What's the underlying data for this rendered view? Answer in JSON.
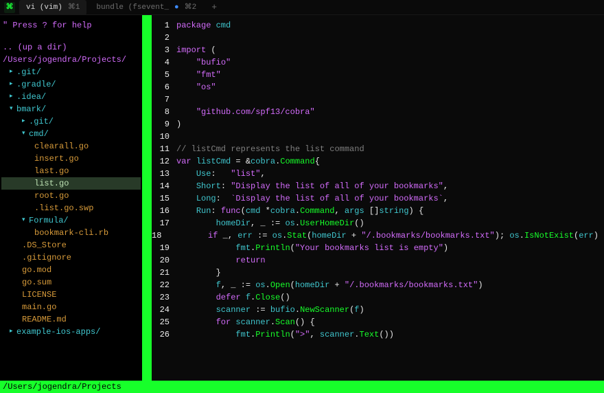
{
  "tabs": [
    {
      "label": "vi (vim)",
      "accel": "⌘1",
      "dot": false
    },
    {
      "label": "bundle (fsevent_",
      "accel": "⌘2",
      "dot": true
    }
  ],
  "help_line": "\" Press ? for help",
  "up_dir": ".. (up a dir)",
  "root_path": "/Users/jogendra/Projects/",
  "tree": [
    {
      "indent": 0,
      "arrow": "▸",
      "type": "dir",
      "name": ".git/"
    },
    {
      "indent": 0,
      "arrow": "▸",
      "type": "dir",
      "name": ".gradle/"
    },
    {
      "indent": 0,
      "arrow": "▸",
      "type": "dir",
      "name": ".idea/"
    },
    {
      "indent": 0,
      "arrow": "▾",
      "type": "dir",
      "name": "bmark/"
    },
    {
      "indent": 1,
      "arrow": "▸",
      "type": "dir",
      "name": ".git/"
    },
    {
      "indent": 1,
      "arrow": "▾",
      "type": "dir",
      "name": "cmd/"
    },
    {
      "indent": 2,
      "arrow": "",
      "type": "file",
      "name": "clearall.go"
    },
    {
      "indent": 2,
      "arrow": "",
      "type": "file",
      "name": "insert.go"
    },
    {
      "indent": 2,
      "arrow": "",
      "type": "file",
      "name": "last.go"
    },
    {
      "indent": 2,
      "arrow": "",
      "type": "file",
      "name": "list.go",
      "selected": true
    },
    {
      "indent": 2,
      "arrow": "",
      "type": "file",
      "name": "root.go"
    },
    {
      "indent": 2,
      "arrow": "",
      "type": "file",
      "name": ".list.go.swp"
    },
    {
      "indent": 1,
      "arrow": "▾",
      "type": "dir",
      "name": "Formula/"
    },
    {
      "indent": 2,
      "arrow": "",
      "type": "file",
      "name": "bookmark-cli.rb"
    },
    {
      "indent": 1,
      "arrow": "",
      "type": "file",
      "name": ".DS_Store"
    },
    {
      "indent": 1,
      "arrow": "",
      "type": "file",
      "name": ".gitignore"
    },
    {
      "indent": 1,
      "arrow": "",
      "type": "file",
      "name": "go.mod"
    },
    {
      "indent": 1,
      "arrow": "",
      "type": "file",
      "name": "go.sum"
    },
    {
      "indent": 1,
      "arrow": "",
      "type": "file",
      "name": "LICENSE"
    },
    {
      "indent": 1,
      "arrow": "",
      "type": "file",
      "name": "main.go"
    },
    {
      "indent": 1,
      "arrow": "",
      "type": "file",
      "name": "README.md"
    },
    {
      "indent": 0,
      "arrow": "▸",
      "type": "dir",
      "name": "example-ios-apps/"
    }
  ],
  "status": "/Users/jogendra/Projects",
  "code": [
    {
      "n": 1,
      "tokens": [
        [
          "kw",
          "package "
        ],
        [
          "ident",
          "cmd"
        ]
      ]
    },
    {
      "n": 2,
      "tokens": []
    },
    {
      "n": 3,
      "tokens": [
        [
          "kw",
          "import "
        ],
        [
          "white",
          "("
        ]
      ]
    },
    {
      "n": 4,
      "tokens": [
        [
          "white",
          "    "
        ],
        [
          "str",
          "\"bufio\""
        ]
      ]
    },
    {
      "n": 5,
      "tokens": [
        [
          "white",
          "    "
        ],
        [
          "str",
          "\"fmt\""
        ]
      ]
    },
    {
      "n": 6,
      "tokens": [
        [
          "white",
          "    "
        ],
        [
          "str",
          "\"os\""
        ]
      ]
    },
    {
      "n": 7,
      "tokens": []
    },
    {
      "n": 8,
      "tokens": [
        [
          "white",
          "    "
        ],
        [
          "str",
          "\"github.com/spf13/cobra\""
        ]
      ]
    },
    {
      "n": 9,
      "tokens": [
        [
          "white",
          ")"
        ]
      ]
    },
    {
      "n": 10,
      "tokens": []
    },
    {
      "n": 11,
      "tokens": [
        [
          "cmt",
          "// listCmd represents the list command"
        ]
      ]
    },
    {
      "n": 12,
      "tokens": [
        [
          "kw",
          "var "
        ],
        [
          "ident",
          "listCmd"
        ],
        [
          "white",
          " = &"
        ],
        [
          "ident",
          "cobra"
        ],
        [
          "white",
          "."
        ],
        [
          "func",
          "Command"
        ],
        [
          "white",
          "{"
        ]
      ]
    },
    {
      "n": 13,
      "tokens": [
        [
          "white",
          "    "
        ],
        [
          "ident",
          "Use"
        ],
        [
          "white",
          ":   "
        ],
        [
          "str",
          "\"list\""
        ],
        [
          "white",
          ","
        ]
      ]
    },
    {
      "n": 14,
      "tokens": [
        [
          "white",
          "    "
        ],
        [
          "ident",
          "Short"
        ],
        [
          "white",
          ": "
        ],
        [
          "str",
          "\"Display the list of all of your bookmarks\""
        ],
        [
          "white",
          ","
        ]
      ]
    },
    {
      "n": 15,
      "tokens": [
        [
          "white",
          "    "
        ],
        [
          "ident",
          "Long"
        ],
        [
          "white",
          ":  "
        ],
        [
          "str",
          "`Display the list of all of your bookmarks`"
        ],
        [
          "white",
          ","
        ]
      ]
    },
    {
      "n": 16,
      "tokens": [
        [
          "white",
          "    "
        ],
        [
          "ident",
          "Run"
        ],
        [
          "white",
          ": "
        ],
        [
          "kw",
          "func"
        ],
        [
          "white",
          "("
        ],
        [
          "ident",
          "cmd"
        ],
        [
          "white",
          " *"
        ],
        [
          "ident",
          "cobra"
        ],
        [
          "white",
          "."
        ],
        [
          "func",
          "Command"
        ],
        [
          "white",
          ", "
        ],
        [
          "ident",
          "args"
        ],
        [
          "white",
          " []"
        ],
        [
          "ident",
          "string"
        ],
        [
          "white",
          ") {"
        ]
      ]
    },
    {
      "n": 17,
      "tokens": [
        [
          "white",
          "        "
        ],
        [
          "ident",
          "homeDir"
        ],
        [
          "white",
          ", _ := "
        ],
        [
          "ident",
          "os"
        ],
        [
          "white",
          "."
        ],
        [
          "func",
          "UserHomeDir"
        ],
        [
          "white",
          "()"
        ]
      ]
    },
    {
      "n": 18,
      "tokens": [
        [
          "white",
          "        "
        ],
        [
          "kw",
          "if"
        ],
        [
          "white",
          " _, "
        ],
        [
          "ident",
          "err"
        ],
        [
          "white",
          " := "
        ],
        [
          "ident",
          "os"
        ],
        [
          "white",
          "."
        ],
        [
          "func",
          "Stat"
        ],
        [
          "white",
          "("
        ],
        [
          "ident",
          "homeDir"
        ],
        [
          "white",
          " + "
        ],
        [
          "str",
          "\"/.bookmarks/bookmarks.txt\""
        ],
        [
          "white",
          "); "
        ],
        [
          "ident",
          "os"
        ],
        [
          "white",
          "."
        ],
        [
          "func",
          "IsNotExist"
        ],
        [
          "white",
          "("
        ],
        [
          "ident",
          "err"
        ],
        [
          "white",
          ") {"
        ]
      ]
    },
    {
      "n": 19,
      "tokens": [
        [
          "white",
          "            "
        ],
        [
          "ident",
          "fmt"
        ],
        [
          "white",
          "."
        ],
        [
          "func",
          "Println"
        ],
        [
          "white",
          "("
        ],
        [
          "str",
          "\"Your bookmarks list is empty\""
        ],
        [
          "white",
          ")"
        ]
      ]
    },
    {
      "n": 20,
      "tokens": [
        [
          "white",
          "            "
        ],
        [
          "kw",
          "return"
        ]
      ]
    },
    {
      "n": 21,
      "tokens": [
        [
          "white",
          "        }"
        ]
      ]
    },
    {
      "n": 22,
      "tokens": [
        [
          "white",
          "        "
        ],
        [
          "ident",
          "f"
        ],
        [
          "white",
          ", _ := "
        ],
        [
          "ident",
          "os"
        ],
        [
          "white",
          "."
        ],
        [
          "func",
          "Open"
        ],
        [
          "white",
          "("
        ],
        [
          "ident",
          "homeDir"
        ],
        [
          "white",
          " + "
        ],
        [
          "str",
          "\"/.bookmarks/bookmarks.txt\""
        ],
        [
          "white",
          ")"
        ]
      ]
    },
    {
      "n": 23,
      "tokens": [
        [
          "white",
          "        "
        ],
        [
          "kw",
          "defer"
        ],
        [
          "white",
          " "
        ],
        [
          "ident",
          "f"
        ],
        [
          "white",
          "."
        ],
        [
          "func",
          "Close"
        ],
        [
          "white",
          "()"
        ]
      ]
    },
    {
      "n": 24,
      "tokens": [
        [
          "white",
          "        "
        ],
        [
          "ident",
          "scanner"
        ],
        [
          "white",
          " := "
        ],
        [
          "ident",
          "bufio"
        ],
        [
          "white",
          "."
        ],
        [
          "func",
          "NewScanner"
        ],
        [
          "white",
          "("
        ],
        [
          "ident",
          "f"
        ],
        [
          "white",
          ")"
        ]
      ]
    },
    {
      "n": 25,
      "tokens": [
        [
          "white",
          "        "
        ],
        [
          "kw",
          "for"
        ],
        [
          "white",
          " "
        ],
        [
          "ident",
          "scanner"
        ],
        [
          "white",
          "."
        ],
        [
          "func",
          "Scan"
        ],
        [
          "white",
          "() {"
        ]
      ]
    },
    {
      "n": 26,
      "tokens": [
        [
          "white",
          "            "
        ],
        [
          "ident",
          "fmt"
        ],
        [
          "white",
          "."
        ],
        [
          "func",
          "Println"
        ],
        [
          "white",
          "("
        ],
        [
          "str",
          "\">\""
        ],
        [
          "white",
          ", "
        ],
        [
          "ident",
          "scanner"
        ],
        [
          "white",
          "."
        ],
        [
          "func",
          "Text"
        ],
        [
          "white",
          "())"
        ]
      ]
    }
  ]
}
